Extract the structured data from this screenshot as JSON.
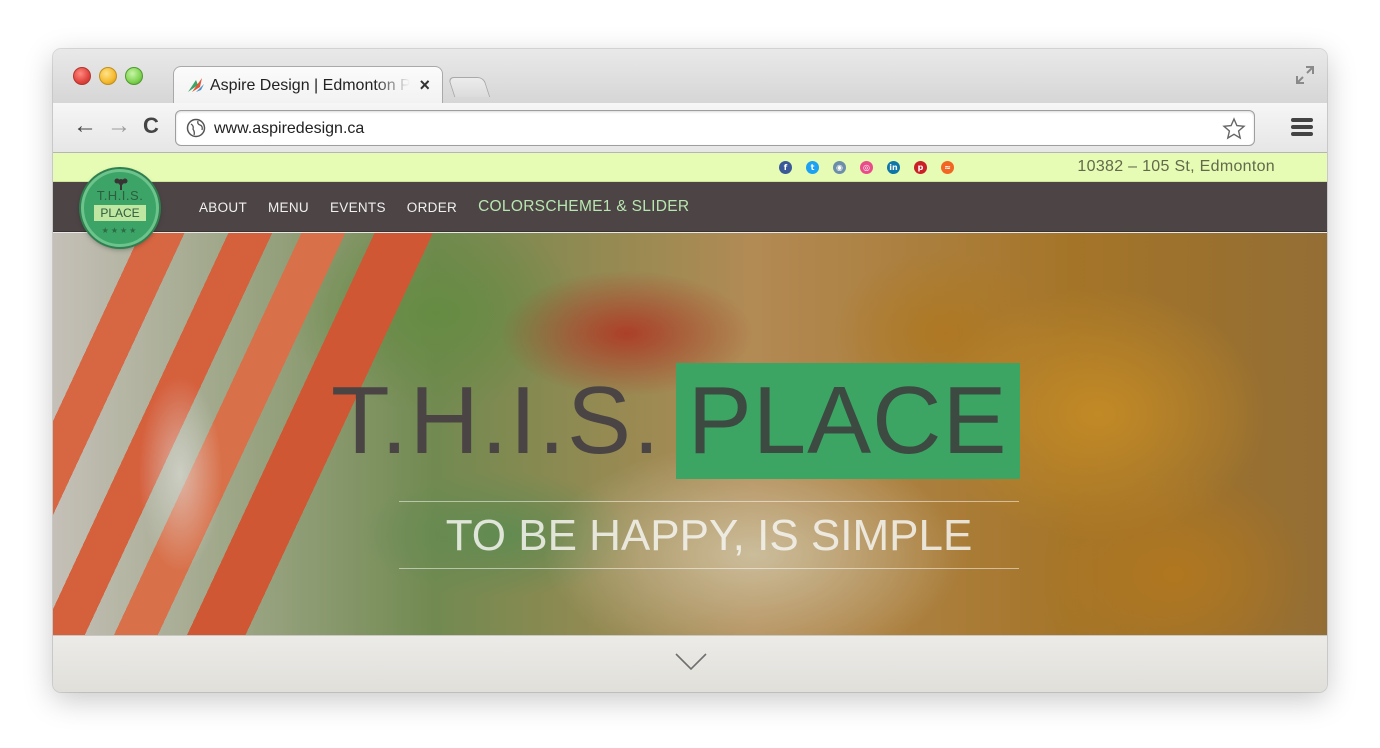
{
  "browser": {
    "tab_title": "Aspire Design | Edmonton Pr",
    "tab_close": "×",
    "url": "www.aspiredesign.ca",
    "back_label": "←",
    "forward_label": "→",
    "reload_label": "C"
  },
  "site": {
    "address": "10382 – 105 St, Edmonton",
    "social": [
      {
        "name": "facebook",
        "glyph": "f",
        "color": "#3b5998"
      },
      {
        "name": "twitter",
        "glyph": "t",
        "color": "#1da1f2"
      },
      {
        "name": "instagram",
        "glyph": "◉",
        "color": "#6c8ea8"
      },
      {
        "name": "dribbble",
        "glyph": "◎",
        "color": "#ea4c89"
      },
      {
        "name": "linkedin",
        "glyph": "in",
        "color": "#0e76a8"
      },
      {
        "name": "pinterest",
        "glyph": "p",
        "color": "#cb2027"
      },
      {
        "name": "rss",
        "glyph": "≈",
        "color": "#f26522"
      }
    ],
    "logo": {
      "top": "T.H.I.S.",
      "bottom": "PLACE",
      "stars": "★★★★"
    },
    "nav": [
      {
        "label": "ABOUT"
      },
      {
        "label": "MENU"
      },
      {
        "label": "EVENTS"
      },
      {
        "label": "ORDER"
      },
      {
        "label": "COLORSCHEME1 & SLIDER"
      }
    ],
    "hero": {
      "title_left": "T.H.I.S.",
      "title_right": "PLACE",
      "tagline": "TO BE HAPPY, IS SIMPLE"
    }
  },
  "colors": {
    "accent_green": "#3ca564",
    "topbar_bg": "#e6fbb4",
    "nav_bg": "#4d4545"
  }
}
